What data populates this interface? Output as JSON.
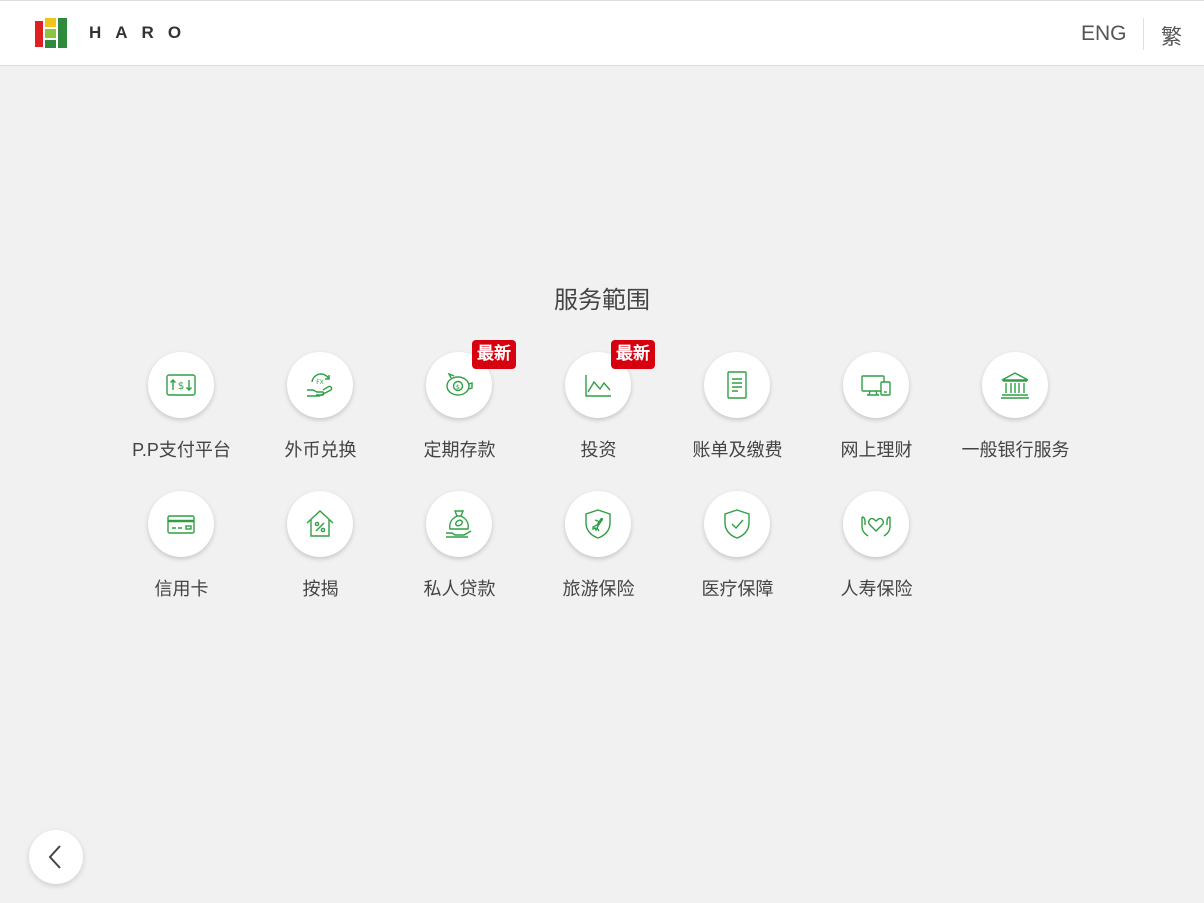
{
  "header": {
    "brand": "HARO",
    "lang_eng": "ENG",
    "lang_traditional": "繁"
  },
  "section": {
    "title": "服务範围"
  },
  "colors": {
    "accent": "#2ea043",
    "badge": "#d7000f"
  },
  "services": [
    {
      "label": "P.P支付平台",
      "icon": "payment-transfer-icon"
    },
    {
      "label": "外币兑换",
      "icon": "fx-exchange-icon"
    },
    {
      "label": "定期存款",
      "icon": "piggy-bank-icon",
      "badge": "最新"
    },
    {
      "label": "投资",
      "icon": "line-chart-icon",
      "badge": "最新"
    },
    {
      "label": "账单及缴费",
      "icon": "bill-document-icon"
    },
    {
      "label": "网上理财",
      "icon": "desktop-devices-icon"
    },
    {
      "label": "一般银行服务",
      "icon": "bank-building-icon"
    },
    {
      "label": "信用卡",
      "icon": "credit-card-icon"
    },
    {
      "label": "按揭",
      "icon": "house-percent-icon"
    },
    {
      "label": "私人贷款",
      "icon": "money-bag-icon"
    },
    {
      "label": "旅游保险",
      "icon": "shield-plane-icon"
    },
    {
      "label": "医疗保障",
      "icon": "shield-check-icon"
    },
    {
      "label": "人寿保险",
      "icon": "hands-heart-icon"
    }
  ],
  "back_button": {
    "icon": "chevron-left-icon"
  }
}
